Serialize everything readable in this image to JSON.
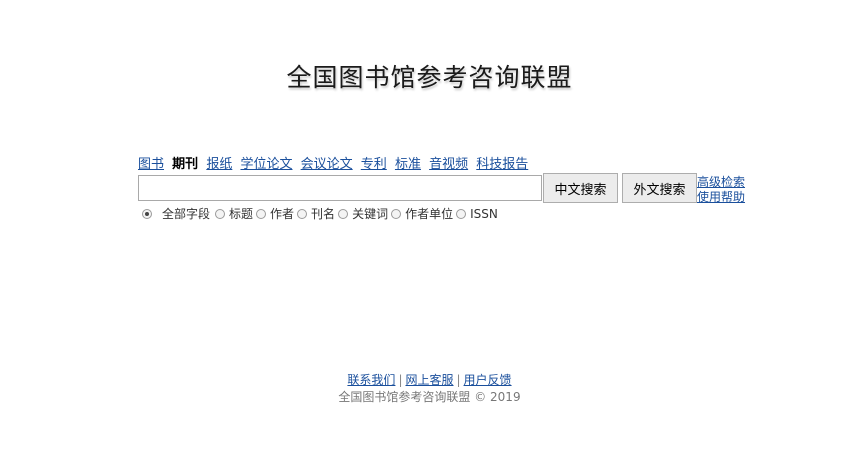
{
  "header": {
    "title": "全国图书馆参考咨询联盟"
  },
  "tabs": [
    {
      "label": "图书",
      "active": false
    },
    {
      "label": "期刊",
      "active": true
    },
    {
      "label": "报纸",
      "active": false
    },
    {
      "label": "学位论文",
      "active": false
    },
    {
      "label": "会议论文",
      "active": false
    },
    {
      "label": "专利",
      "active": false
    },
    {
      "label": "标准",
      "active": false
    },
    {
      "label": "音视频",
      "active": false
    },
    {
      "label": "科技报告",
      "active": false
    }
  ],
  "search": {
    "value": "",
    "placeholder": "",
    "cn_button": "中文搜索",
    "en_button": "外文搜索",
    "advanced_link": "高级检索",
    "help_link": "使用帮助"
  },
  "fields": [
    {
      "label": "全部字段",
      "checked": true
    },
    {
      "label": "标题",
      "checked": false
    },
    {
      "label": "作者",
      "checked": false
    },
    {
      "label": "刊名",
      "checked": false
    },
    {
      "label": "关键词",
      "checked": false
    },
    {
      "label": "作者单位",
      "checked": false
    },
    {
      "label": "ISSN",
      "checked": false
    }
  ],
  "footer": {
    "links": [
      "联系我们",
      "网上客服",
      "用户反馈"
    ],
    "separator": "|",
    "copyright": "全国图书馆参考咨询联盟 © 2019"
  }
}
